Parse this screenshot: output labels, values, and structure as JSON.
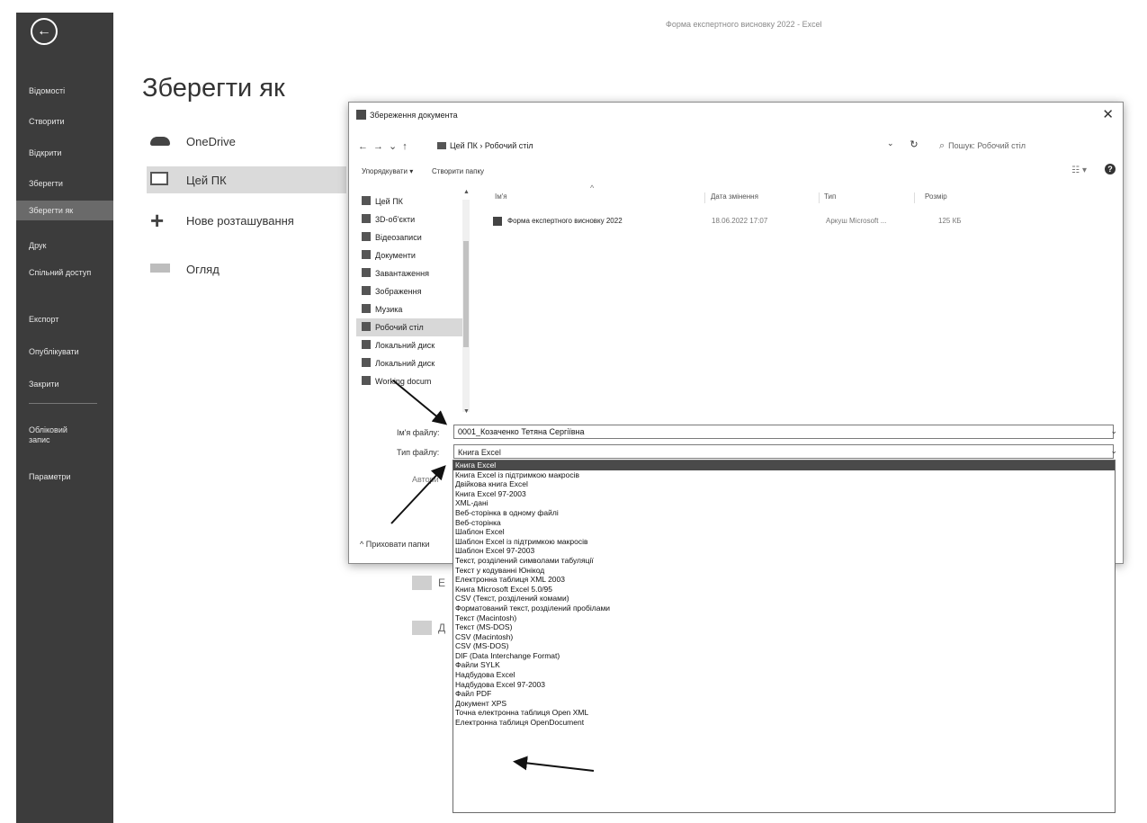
{
  "window_title": "Форма експертного висновку 2022 - Excel",
  "backstage": {
    "title": "Зберегти як",
    "rail": [
      "Відомості",
      "Створити",
      "Відкрити",
      "Зберегти",
      "Зберегти як",
      "Друк",
      "Спільний доступ",
      "Експорт",
      "Опублікувати",
      "Закрити",
      "Обліковий запис",
      "Параметри"
    ],
    "rail_selected": "Зберегти як",
    "locations": [
      "OneDrive",
      "Цей ПК",
      "Нове розташування",
      "Огляд"
    ],
    "faded": [
      "Е",
      "Д"
    ]
  },
  "dialog": {
    "title": "Збереження документа",
    "address": "Цей ПК  ›  Робочий стіл",
    "search_placeholder": "Пошук: Робочий стіл",
    "organize": "Упорядкувати ▾",
    "new_folder": "Створити папку",
    "nav": [
      "Цей ПК",
      "3D-об'єкти",
      "Відеозаписи",
      "Документи",
      "Завантаження",
      "Зображення",
      "Музика",
      "Робочий стіл",
      "Локальний диск",
      "Локальний диск",
      "Working docum"
    ],
    "nav_selected": "Робочий стіл",
    "columns": {
      "name": "Ім'я",
      "date": "Дата змінення",
      "type": "Тип",
      "size": "Розмір"
    },
    "file": {
      "name": "Форма експертного висновку 2022",
      "date": "18.06.2022 17:07",
      "type": "Аркуш Microsoft ...",
      "size": "125 КБ"
    },
    "filename_label": "Ім'я файлу:",
    "filename_value": "0001_Козаченко Тетяна Сергіївна",
    "filetype_label": "Тип файлу:",
    "filetype_value": "Книга Excel",
    "authors_label": "Автори",
    "hide_folders": "Приховати папки"
  },
  "filetypes": [
    "Книга Excel",
    "Книга Excel із підтримкою макросів",
    "Двійкова книга Excel",
    "Книга Excel 97-2003",
    "XML-дані",
    "Веб-сторінка в одному файлі",
    "Веб-сторінка",
    "Шаблон Excel",
    "Шаблон Excel із підтримкою макросів",
    "Шаблон Excel 97-2003",
    "Текст, розділений символами табуляції",
    "Текст у кодуванні Юнікод",
    "Електронна таблиця XML 2003",
    "Книга Microsoft Excel 5.0/95",
    "CSV (Текст, розділений комами)",
    "Форматований текст, розділений пробілами",
    "Текст (Macintosh)",
    "Текст (MS-DOS)",
    "CSV (Macintosh)",
    "CSV (MS-DOS)",
    "DIF (Data Interchange Format)",
    "Файли SYLK",
    "Надбудова Excel",
    "Надбудова Excel 97-2003",
    "Файл PDF",
    "Документ XPS",
    "Точна електронна таблиця Open XML",
    "Електронна таблиця OpenDocument"
  ],
  "filetype_selected_index": 0
}
